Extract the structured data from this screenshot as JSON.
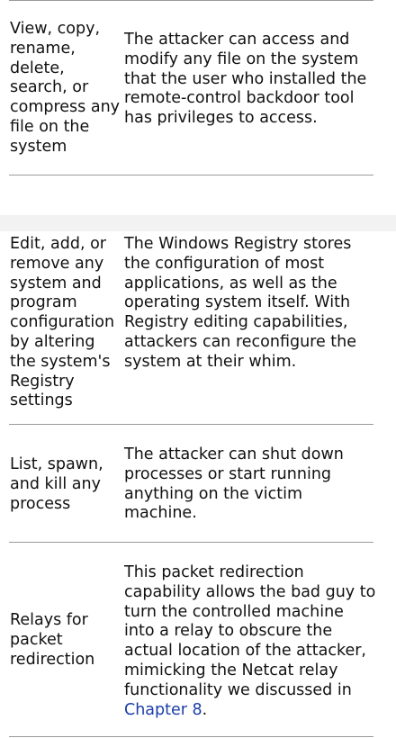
{
  "rows": [
    {
      "capability": "View, copy, rename, delete, search, or compress any file on the system",
      "description": "The attacker can access and modify any file on the system that the user who installed the remote-control backdoor tool has privileges to access."
    },
    {
      "capability": "Edit, add, or remove any system and program configuration by altering the system's Registry settings",
      "description": "The Windows Registry stores the configuration of most applications, as well as the operating system itself. With Registry editing capabilities, attackers can reconfigure the system at their whim."
    },
    {
      "capability": "List, spawn, and kill any process",
      "description": "The attacker can shut down processes or start running anything on the victim machine."
    },
    {
      "capability": "Relays for packet redirection",
      "description": "This packet redirection capability allows the bad guy to turn the controlled machine into a relay to obscure the actual location of the attacker, mimicking the Netcat relay functionality we discussed in",
      "link_text": "Chapter 8",
      "trailing": "."
    }
  ]
}
